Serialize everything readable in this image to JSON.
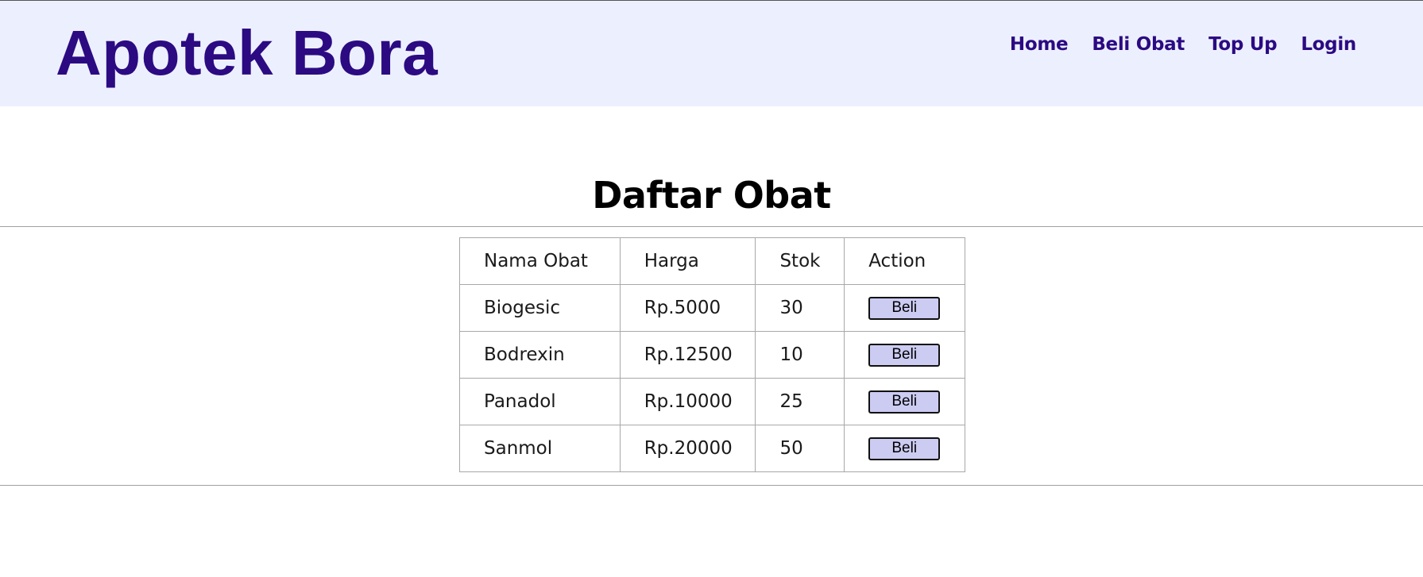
{
  "header": {
    "brand": "Apotek Bora",
    "nav": [
      "Home",
      "Beli Obat",
      "Top Up",
      "Login"
    ]
  },
  "main": {
    "title": "Daftar Obat",
    "table": {
      "columns": [
        "Nama Obat",
        "Harga",
        "Stok",
        "Action"
      ],
      "rows": [
        {
          "nama": "Biogesic",
          "harga": "Rp.5000",
          "stok": "30",
          "action": "Beli"
        },
        {
          "nama": "Bodrexin",
          "harga": "Rp.12500",
          "stok": "10",
          "action": "Beli"
        },
        {
          "nama": "Panadol",
          "harga": "Rp.10000",
          "stok": "25",
          "action": "Beli"
        },
        {
          "nama": "Sanmol",
          "harga": "Rp.20000",
          "stok": "50",
          "action": "Beli"
        }
      ]
    }
  },
  "colors": {
    "brand": "#2c0a82",
    "header_bg": "#ecf0fe",
    "button_bg": "#cccbf2"
  }
}
